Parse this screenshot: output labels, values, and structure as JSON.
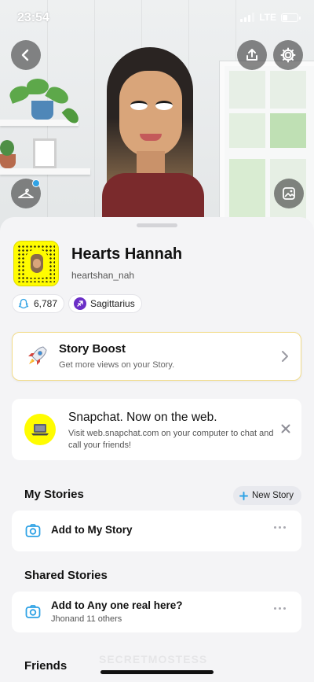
{
  "status_bar": {
    "time": "23:54",
    "network": "LTE",
    "battery_level": 0.3
  },
  "profile": {
    "display_name": "Hearts Hannah",
    "username": "heartshan_nah",
    "score": "6,787",
    "zodiac": "Sagittarius"
  },
  "story_boost": {
    "title": "Story Boost",
    "subtitle": "Get more views on your Story."
  },
  "web_promo": {
    "title": "Snapchat. Now on the web.",
    "body": "Visit web.snapchat.com on your computer to chat and call your friends!"
  },
  "my_stories": {
    "heading": "My Stories",
    "new_story_label": "New Story",
    "add_label": "Add to My Story"
  },
  "shared_stories": {
    "heading": "Shared Stories",
    "item_title": "Add to Any one real here?",
    "item_subtitle": "Jhonand 11 others"
  },
  "friends": {
    "heading": "Friends"
  },
  "watermark": "SECRETMOSTESS",
  "colors": {
    "snap_yellow": "#fffc00",
    "accent_blue": "#2fa2e5",
    "zodiac_purple": "#6b2fc7"
  },
  "icons": {
    "back": "chevron-left-icon",
    "upload": "upload-icon",
    "settings": "gear-icon",
    "closet": "hanger-icon",
    "background": "image-icon",
    "boost": "rocket-icon",
    "laptop": "laptop-icon",
    "camera": "camera-icon"
  }
}
